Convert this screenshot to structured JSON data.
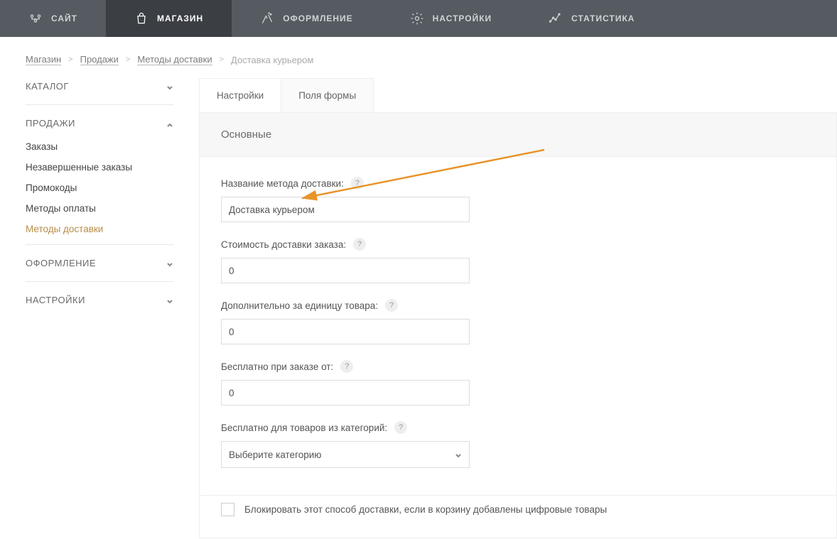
{
  "topnav": {
    "items": [
      {
        "label": "САЙТ",
        "icon": "site-icon"
      },
      {
        "label": "МАГАЗИН",
        "icon": "shop-icon"
      },
      {
        "label": "ОФОРМЛЕНИЕ",
        "icon": "design-icon"
      },
      {
        "label": "НАСТРОЙКИ",
        "icon": "gear-icon"
      },
      {
        "label": "СТАТИСТИКА",
        "icon": "stats-icon"
      }
    ]
  },
  "breadcrumb": {
    "items": [
      "Магазин",
      "Продажи",
      "Методы доставки"
    ],
    "current": "Доставка курьером"
  },
  "sidebar": {
    "sections": [
      {
        "title": "КАТАЛОГ",
        "expanded": false
      },
      {
        "title": "ПРОДАЖИ",
        "expanded": true,
        "items": [
          "Заказы",
          "Незавершенные заказы",
          "Промокоды",
          "Методы оплаты",
          "Методы доставки"
        ],
        "activeIndex": 4
      },
      {
        "title": "ОФОРМЛЕНИЕ",
        "expanded": false
      },
      {
        "title": "НАСТРОЙКИ",
        "expanded": false
      }
    ]
  },
  "tabs": {
    "items": [
      "Настройки",
      "Поля формы"
    ],
    "active": 0
  },
  "subheader": "Основные",
  "form": {
    "nameLabel": "Название метода доставки:",
    "nameValue": "Доставка курьером",
    "costLabel": "Стоимость доставки заказа:",
    "costValue": "0",
    "perUnitLabel": "Дополнительно за единицу товара:",
    "perUnitValue": "0",
    "freeFromLabel": "Бесплатно при заказе от:",
    "freeFromValue": "0",
    "freeCatsLabel": "Бесплатно для товаров из категорий:",
    "freeCatsPlaceholder": "Выберите категорию",
    "blockDigitalLabel": "Блокировать этот способ доставки, если в корзину добавлены цифровые товары",
    "help": "?"
  }
}
